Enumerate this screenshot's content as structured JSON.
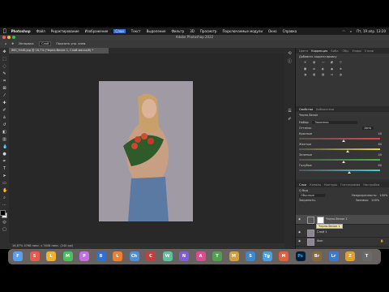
{
  "mac_menu": {
    "app": "Photoshop",
    "items": [
      "Файл",
      "Редактирование",
      "Изображение",
      "Слои",
      "Текст",
      "Выделение",
      "Фильтр",
      "3D",
      "Просмотр",
      "Подключаемые модули",
      "Окно",
      "Справка"
    ],
    "selected_index": 3,
    "clock": "Пт, 19 апр. 13:20"
  },
  "window": {
    "title": "Adobe Photoshop 2022"
  },
  "options_bar": {
    "mode_label": "Интервал:",
    "mode_value": "Слой",
    "auto_select": "Показать упр. элем."
  },
  "document": {
    "tab": "IMG_9448.jpg @ 16,7% (Черно-белое 1, Слой-маска/8) *",
    "status": "16,67%   4768 пикс. x 3008 пикс. (240 ppi)"
  },
  "adjustments_panel": {
    "tabs": [
      "Цвета",
      "Коррекция",
      "Библ.",
      "Обр.",
      "Узоры",
      "Стили"
    ],
    "active_tab": 1,
    "add_label": "Добавить корректировку"
  },
  "properties_panel": {
    "tabs": [
      "Свойства",
      "Библиотеки"
    ],
    "title": "Черно-белое",
    "preset_label": "Набор:",
    "preset_value": "Заказная",
    "tint_label": "Оттенок",
    "auto_label": "Авто",
    "sliders": [
      {
        "name": "Красные",
        "value": "40",
        "fraction": 0.55,
        "color": "#d84a4a"
      },
      {
        "name": "Желтые",
        "value": "60",
        "fraction": 0.6,
        "color": "#e0d04a"
      },
      {
        "name": "Зеленые",
        "value": "40",
        "fraction": 0.55,
        "color": "#4ab04a"
      },
      {
        "name": "Голубые",
        "value": "60",
        "fraction": 0.62,
        "color": "#4ac8d8"
      }
    ]
  },
  "layers_panel": {
    "tabs": [
      "Слои",
      "Каналы",
      "Контуры",
      "Гистограмма",
      "Настройки"
    ],
    "filter_label": "Q Вид",
    "blend": "Обычные",
    "opacity_label": "Непрозрачность:",
    "opacity": "100%",
    "lock_label": "Закрепить:",
    "fill_label": "Заливка:",
    "fill": "100%",
    "layers": [
      "Черно-белое 1",
      "Слой 1",
      "Фон"
    ],
    "tooltip": "Черно-белое 1"
  },
  "dock_apps": [
    "F",
    "S",
    "L",
    "M",
    "P",
    "B",
    "L",
    "Ch",
    "C",
    "W",
    "N",
    "A",
    "T",
    "M",
    "S",
    "Tg",
    "M",
    "Ps",
    "Br",
    "Lr",
    "Z",
    "T"
  ],
  "colors": {
    "accent": "#3a6fd8",
    "ps_blue": "#31a8ff"
  }
}
